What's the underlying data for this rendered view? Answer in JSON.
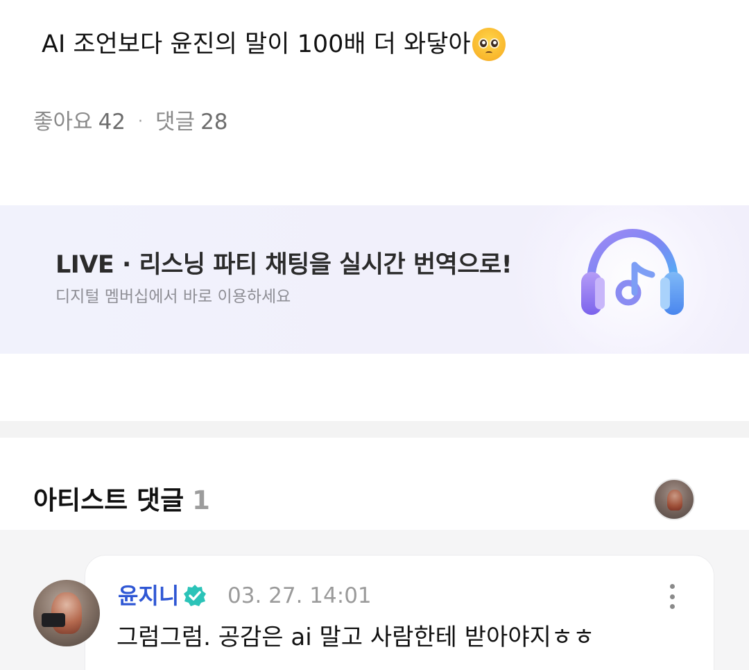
{
  "post": {
    "text": "AI 조언보다 윤진의 말이 100배 더 와닿아",
    "emoji": "pleading-face-emoji"
  },
  "stats": {
    "likes_label": "좋아요",
    "likes_count": "42",
    "separator": "·",
    "comments_label": "댓글",
    "comments_count": "28"
  },
  "banner": {
    "title": "LIVE · 리스닝 파티 채팅을 실시간 번역으로!",
    "subtitle": "디지털 멤버십에서 바로 이용하세요",
    "icon": "headphones-music-note-icon"
  },
  "artist_comments": {
    "title": "아티스트 댓글",
    "count": "1",
    "comments": [
      {
        "author": "윤지니",
        "verified_icon": "verified-badge-icon",
        "timestamp": "03. 27. 14:01",
        "text": "그럼그럼. 공감은 ai 말고 사람한테 받아야지ㅎㅎ"
      }
    ]
  },
  "colors": {
    "author_name": "#2f57d4",
    "verified_badge": "#2bc3b8",
    "headphone_gradient_start": "#8a7bf2",
    "headphone_gradient_end": "#4fb2f5"
  }
}
